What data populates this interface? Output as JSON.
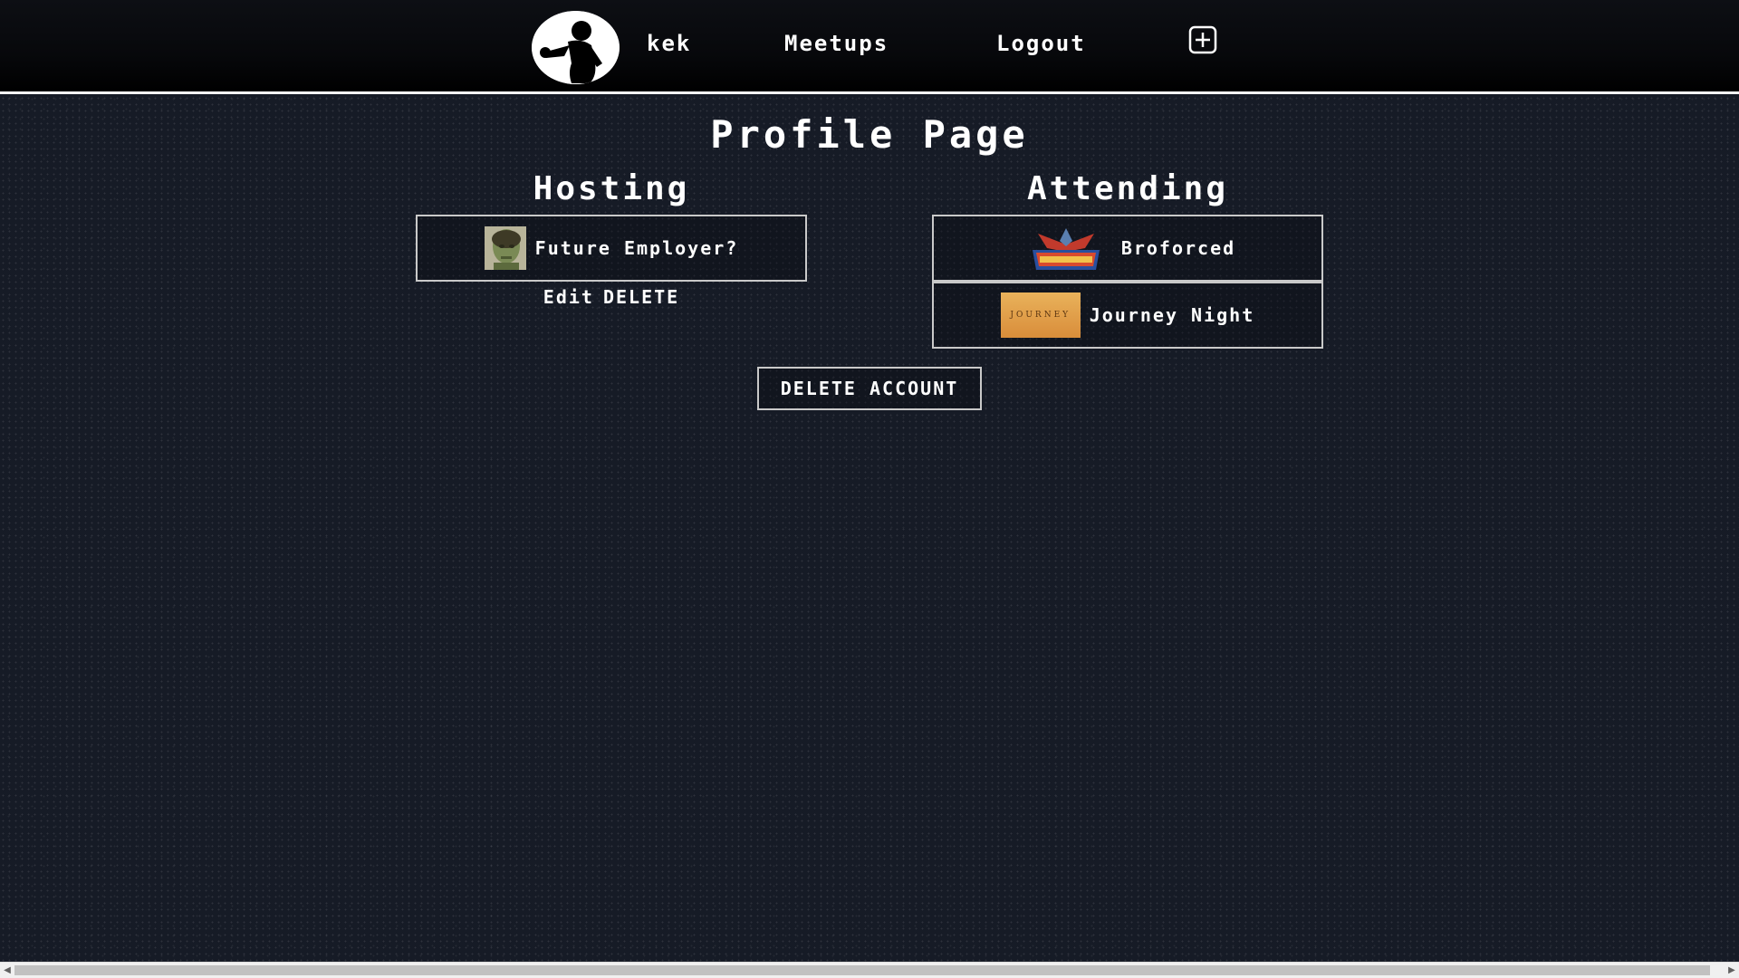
{
  "nav": {
    "username": "kek",
    "meetups": "Meetups",
    "logout": "Logout",
    "add_icon": "plus-square-icon",
    "logo_icon": "silhouette-logo-icon"
  },
  "page": {
    "title": "Profile Page"
  },
  "hosting": {
    "title": "Hosting",
    "items": [
      {
        "label": "Future Employer?",
        "thumb": "face-thumbnail"
      }
    ],
    "edit_label": "Edit",
    "delete_label": "DELETE"
  },
  "attending": {
    "title": "Attending",
    "items": [
      {
        "label": "Broforced",
        "thumb": "broforce-logo-thumbnail"
      },
      {
        "label": "Journey Night",
        "thumb": "journey-thumbnail",
        "thumb_text": "JOURNEY"
      }
    ]
  },
  "account": {
    "delete_label": "DELETE ACCOUNT"
  },
  "colors": {
    "background": "#161b26",
    "text": "#ffffff",
    "border": "#c9c9c9"
  }
}
